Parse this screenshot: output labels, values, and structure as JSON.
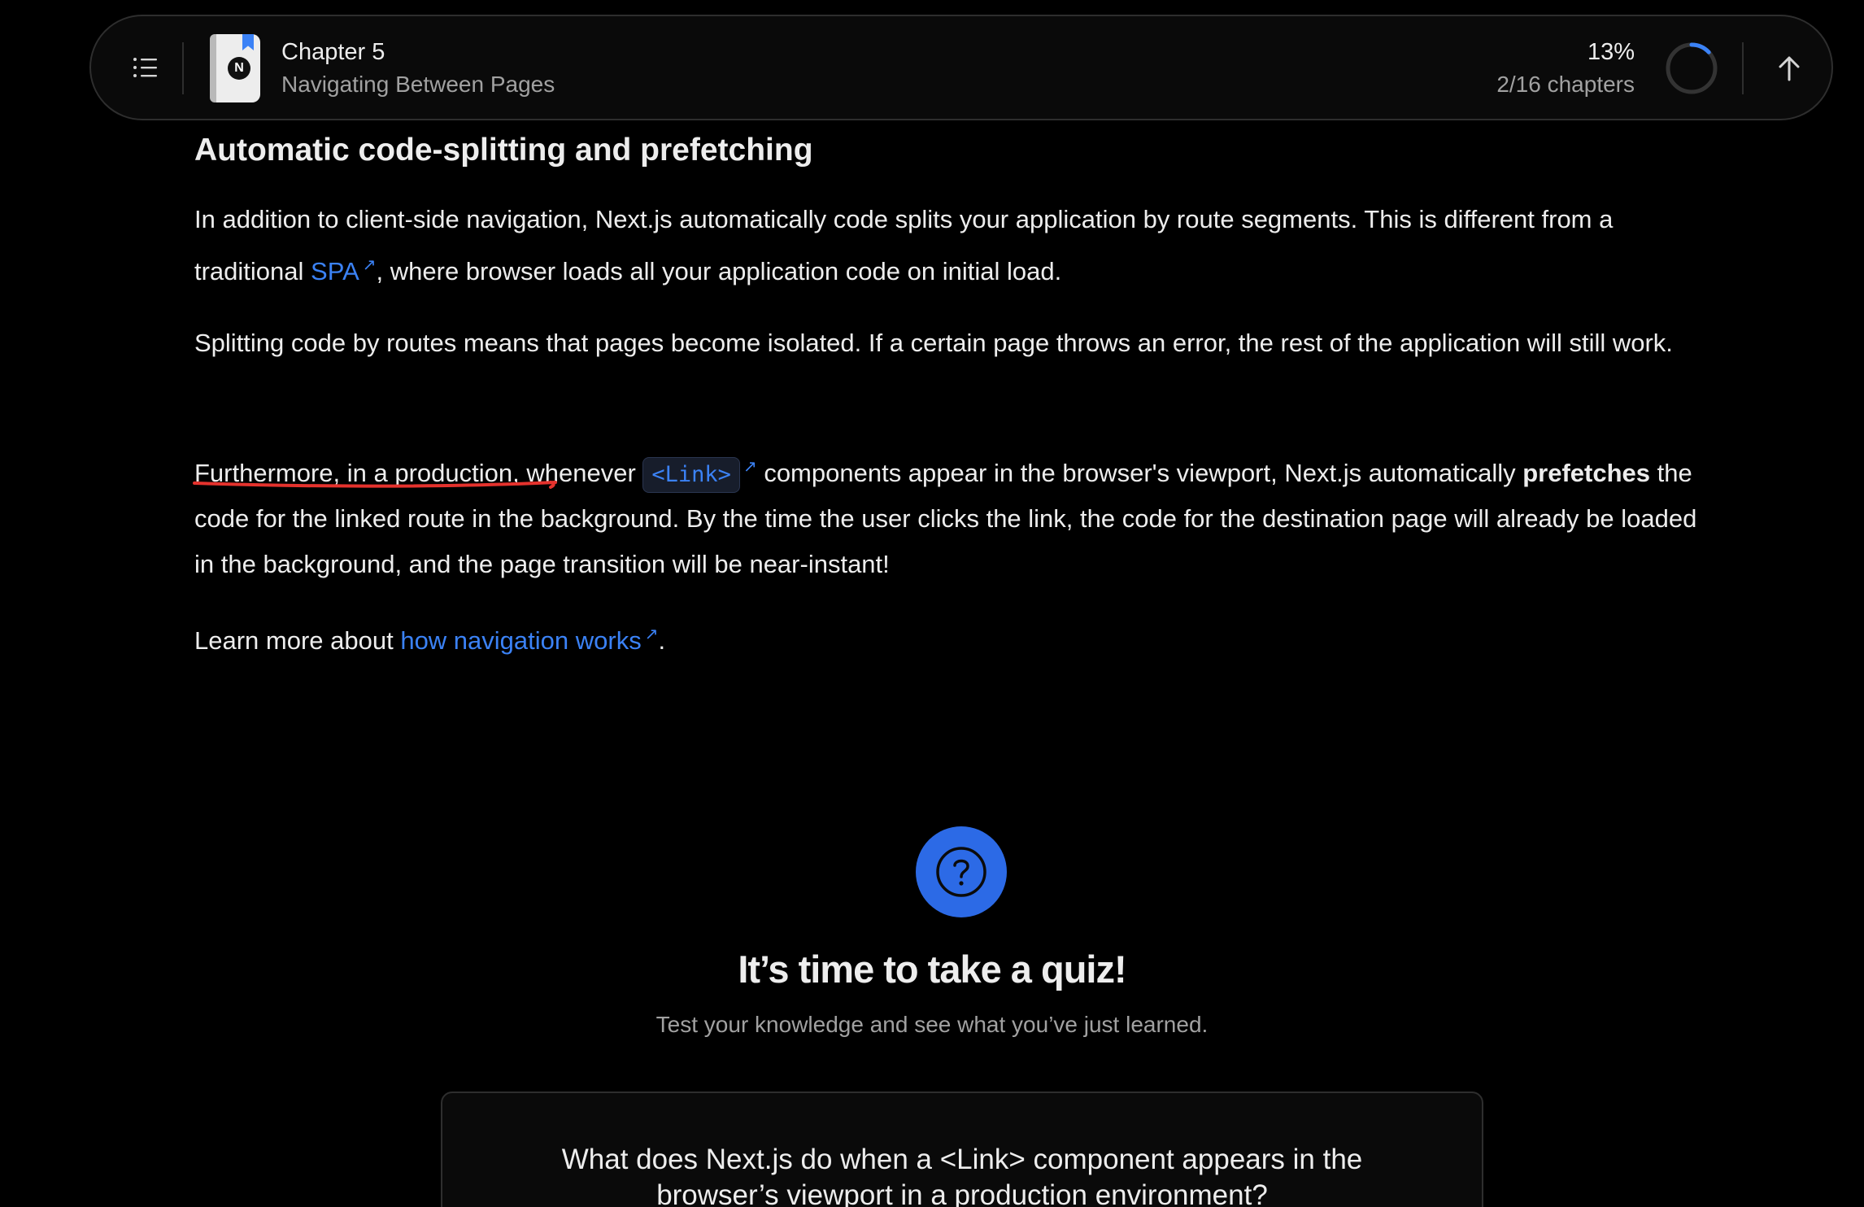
{
  "topbar": {
    "chapter_label": "Chapter 5",
    "chapter_title": "Navigating Between Pages",
    "progress_percent": "13%",
    "progress_chapters": "2/16 chapters",
    "progress_value": 0.13,
    "icons": {
      "menu": "list-icon",
      "book": "nextjs-book-icon",
      "progress": "progress-ring-icon",
      "back_to_top": "arrow-up-icon"
    }
  },
  "article": {
    "heading": "Automatic code-splitting and prefetching",
    "p1": {
      "text_before": "In addition to client-side navigation, Next.js automatically code splits your application by route segments. This is different from a traditional ",
      "link": "SPA",
      "text_after": ", where browser loads all your application code on initial load."
    },
    "p2": "Splitting code by routes means that pages become isolated. If a certain page throws an error, the rest of the application will still work.",
    "p3": {
      "underlined": "Furthermore, in a production,",
      "text_before_code": " whenever ",
      "code": "<Link>",
      "text_after_code": " components appear in the browser's viewport, Next.js automatically ",
      "bold": "prefetches",
      "text_end": " the code for the linked route in the background. By the time the user clicks the link, the code for the destination page will already be loaded in the background, and the page transition will be near-instant!"
    },
    "p4": {
      "text_before": "Learn more about ",
      "link": "how navigation works",
      "text_after": "."
    },
    "external_link_icon": "↗"
  },
  "quiz": {
    "icon": "question-circle-icon",
    "title": "It’s time to take a quiz!",
    "subtitle": "Test your knowledge and see what you’ve just learned.",
    "question": "What does Next.js do when a <Link> component appears in the browser’s viewport in a production environment?"
  },
  "colors": {
    "background": "#000000",
    "link": "#3b82f6",
    "quiz_icon_bg": "#2c6ae6",
    "annotation_underline": "#e5322d"
  }
}
